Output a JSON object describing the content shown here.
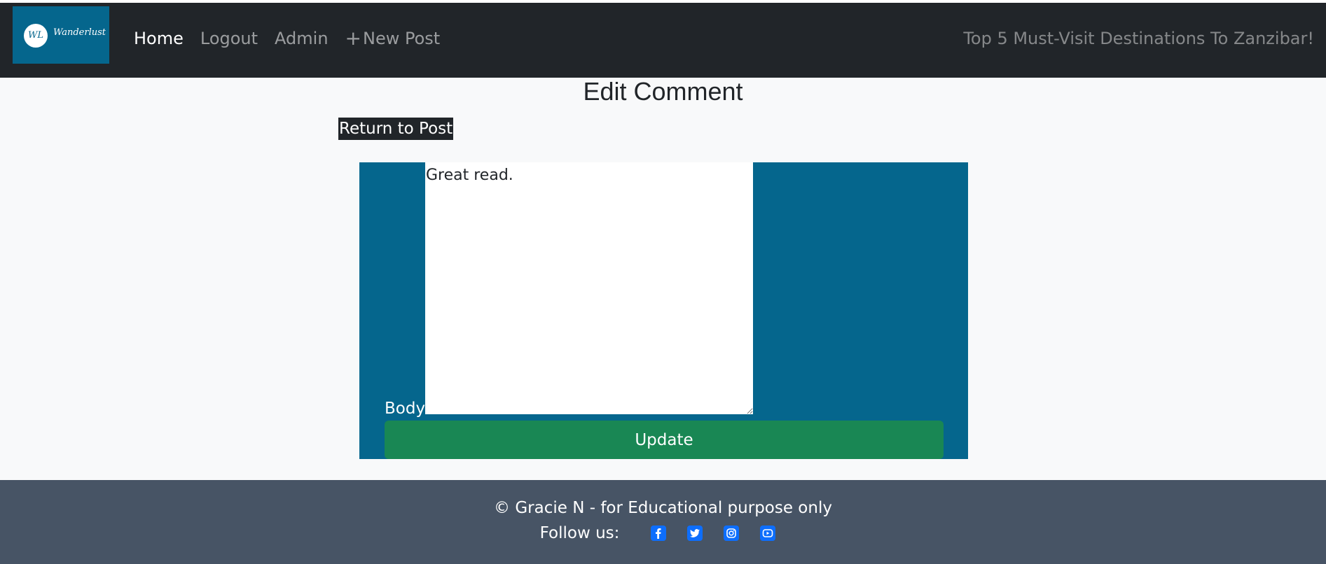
{
  "header": {
    "logo_initials": "WL",
    "logo_text": "Wanderlust",
    "nav": [
      {
        "label": "Home"
      },
      {
        "label": "Logout"
      },
      {
        "label": "Admin"
      },
      {
        "label": "New Post"
      }
    ],
    "tagline": "Top 5 Must-Visit Destinations To Zanzibar!"
  },
  "main": {
    "title": "Edit Comment",
    "return_label": "Return to Post",
    "body_label": "Body:",
    "body_value": "Great read.",
    "update_label": "Update"
  },
  "footer": {
    "copyright": "© Gracie N - for Educational purpose only",
    "follow_label": "Follow us:",
    "social_icons": [
      "facebook-icon",
      "twitter-icon",
      "instagram-icon",
      "youtube-icon"
    ]
  },
  "colors": {
    "navbar": "#212529",
    "brand": "#05668d",
    "success": "#198754",
    "footer": "#475465",
    "social": "#0d6efd"
  }
}
